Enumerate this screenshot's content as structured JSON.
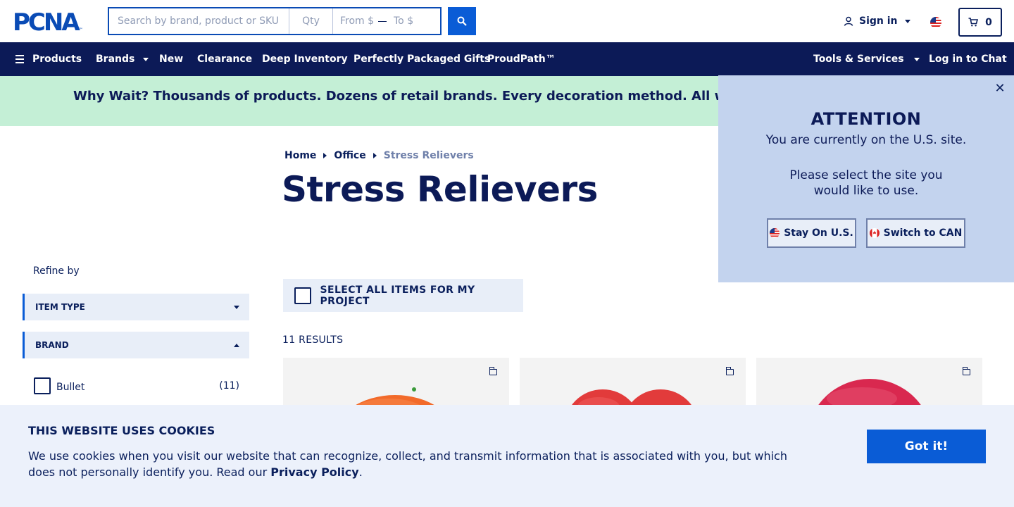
{
  "header": {
    "logo_text": "PCNA",
    "logo_tm": "™",
    "search_placeholder": "Search by brand, product or SKU",
    "qty_placeholder": "Qty",
    "price_from_placeholder": "From $",
    "price_to_placeholder": "To $",
    "sign_in_label": "Sign in",
    "cart_count": "0"
  },
  "nav": {
    "items": [
      "Products",
      "Brands",
      "New",
      "Clearance",
      "Deep Inventory",
      "Perfectly Packaged Gifts",
      "ProudPath™"
    ],
    "tools_label": "Tools & Services",
    "chat_label": "Log in to Chat"
  },
  "promo": {
    "text": "Why Wait? Thousands of products. Dozens of retail brands. Every decoration method. All with a standard"
  },
  "breadcrumb": {
    "items": [
      "Home",
      "Office"
    ],
    "current": "Stress Relievers"
  },
  "page_title": "Stress Relievers",
  "refine": {
    "label": "Refine by",
    "facets": [
      "ITEM TYPE",
      "BRAND"
    ],
    "brand_options": [
      {
        "label": "Bullet",
        "count": "(11)"
      }
    ]
  },
  "select_all_label": "SELECT ALL ITEMS FOR MY PROJECT",
  "results_label": "11 RESULTS",
  "products": [
    {
      "icon": "orange-stress-ball-image",
      "color": "#f26a2a"
    },
    {
      "icon": "heart-stress-ball-image",
      "color": "#e23b3b"
    },
    {
      "icon": "red-stress-ball-image",
      "color": "#d9284f"
    }
  ],
  "attention": {
    "title": "ATTENTION",
    "line1": "You are currently on the U.S. site.",
    "line2": "Please select the site you",
    "line3": "would like to use.",
    "stay_label": "Stay On U.S.",
    "switch_label": "Switch to CAN"
  },
  "cookies": {
    "title": "THIS WEBSITE USES COOKIES",
    "text": "We use cookies when you visit our website that can recognize, collect, and transmit information that is associated with you, but which does not personally identify you. Read our ",
    "link": "Privacy Policy",
    "after": ".",
    "button": "Got it!"
  },
  "colors": {
    "navy": "#0c1a57",
    "brand_blue": "#0a5cd6",
    "promo_bg": "#c4efd6",
    "attention_bg": "#c3d3ee"
  }
}
